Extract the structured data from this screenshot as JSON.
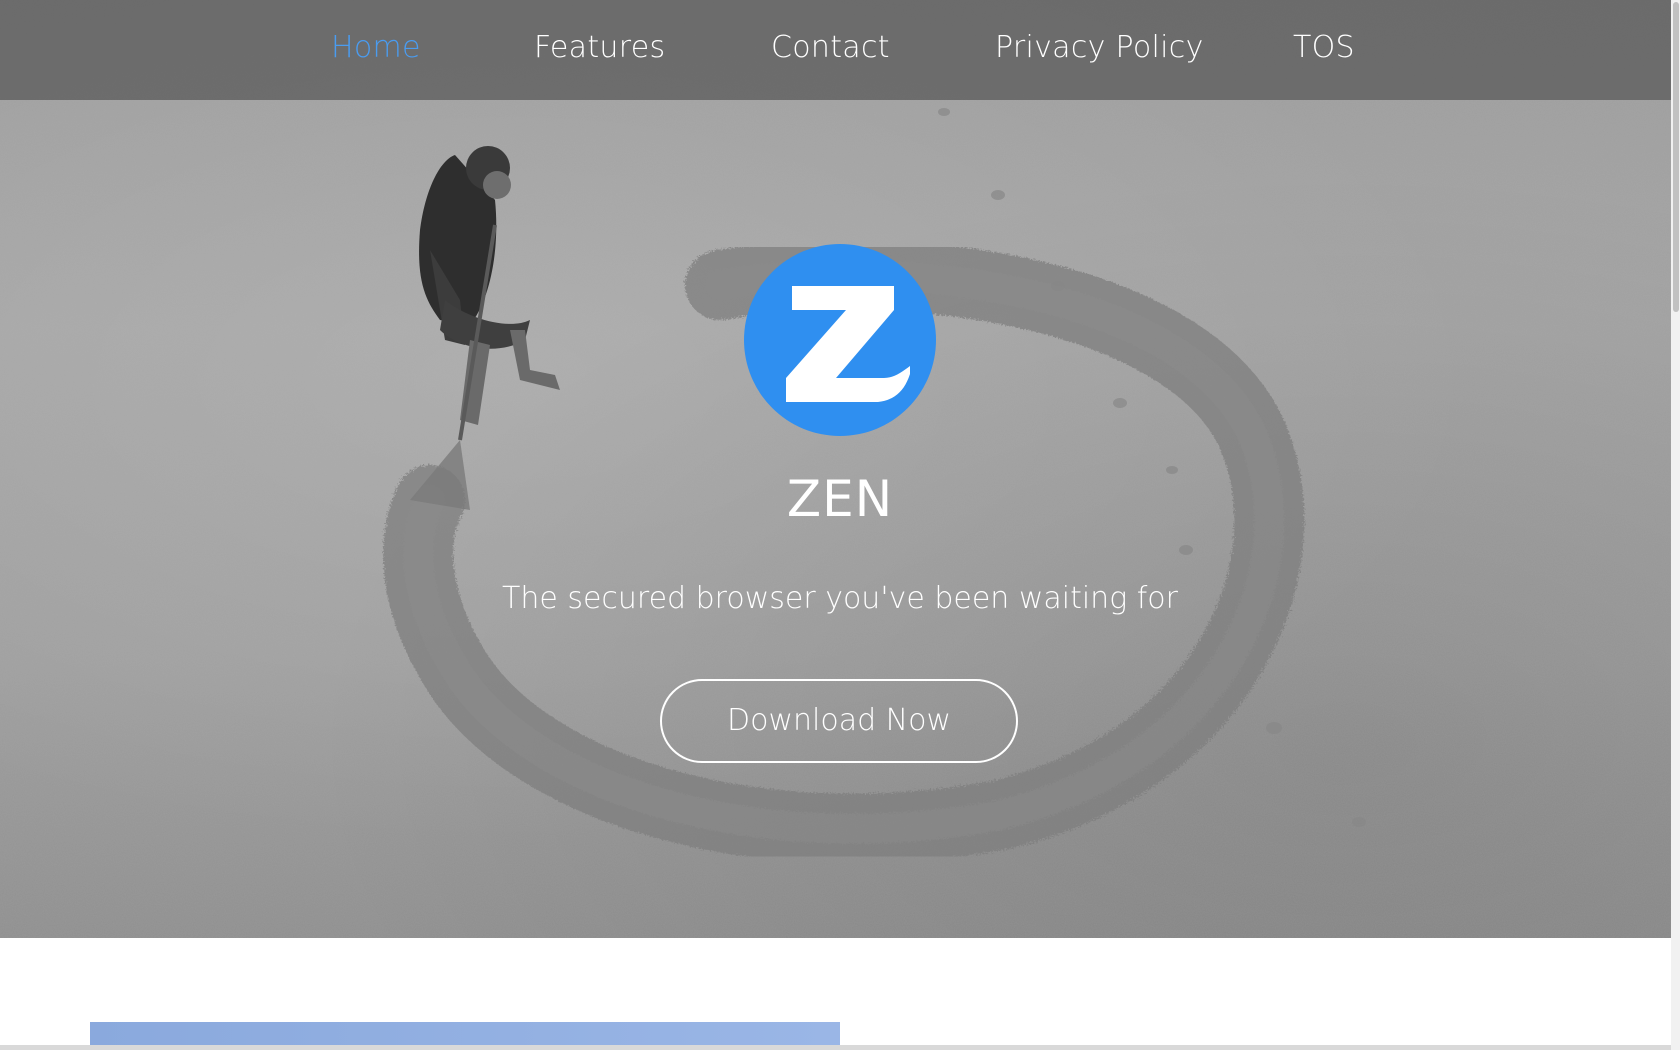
{
  "nav": {
    "items": [
      {
        "label": "Home",
        "active": true
      },
      {
        "label": "Features",
        "active": false
      },
      {
        "label": "Contact",
        "active": false
      },
      {
        "label": "Privacy Policy",
        "active": false
      },
      {
        "label": "TOS",
        "active": false
      }
    ],
    "active_color": "#4a9cf0",
    "text_color": "#ffffff"
  },
  "hero": {
    "logo_icon": "zen-logo-icon",
    "logo_color": "#2f8ff0",
    "brand": "ZEN",
    "tagline": "The secured browser you've been waiting for",
    "cta_label": "Download Now"
  },
  "colors": {
    "accent": "#2f8ff0",
    "lower_bar": "#8aa9dd"
  }
}
